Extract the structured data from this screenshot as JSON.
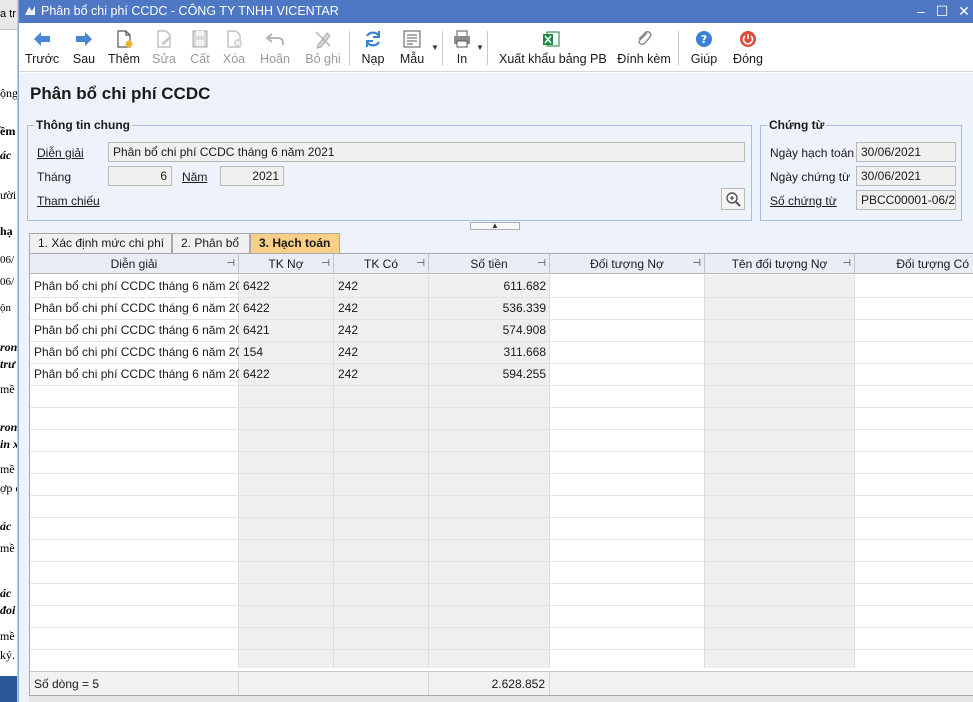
{
  "background_doc": {
    "top_text": "a tr",
    "lines": [
      "ộng",
      "ềm",
      "ác",
      "ười",
      "hạ",
      "06/",
      "06/",
      "ộn",
      "ron",
      "trư",
      "mề",
      "ron",
      "in x",
      "mề",
      "ợp c",
      "ác",
      "mề",
      "ác",
      "đoi",
      "mề",
      "ký."
    ]
  },
  "window": {
    "title": "Phân bổ chi phí CCDC - CÔNG TY TNHH VICENTAR",
    "controls": {
      "minimize": "–",
      "maximize": "☐",
      "close": "✕"
    }
  },
  "toolbar": {
    "items": [
      {
        "label": "Trước",
        "icon": "arrow-left-icon",
        "enabled": true
      },
      {
        "label": "Sau",
        "icon": "arrow-right-icon",
        "enabled": true
      },
      {
        "label": "Thêm",
        "icon": "new-document-icon",
        "enabled": true
      },
      {
        "label": "Sửa",
        "icon": "edit-icon",
        "enabled": false
      },
      {
        "label": "Cất",
        "icon": "save-icon",
        "enabled": false
      },
      {
        "label": "Xóa",
        "icon": "delete-icon",
        "enabled": false
      },
      {
        "label": "Hoãn",
        "icon": "undo-icon",
        "enabled": false
      },
      {
        "label": "Bỏ ghi",
        "icon": "unpost-icon",
        "enabled": false
      },
      {
        "label": "Nạp",
        "icon": "refresh-icon",
        "enabled": true
      },
      {
        "label": "Mẫu",
        "icon": "template-icon",
        "enabled": true
      },
      {
        "label": "In",
        "icon": "print-icon",
        "enabled": true
      },
      {
        "label": "Xuất khẩu bảng PB",
        "icon": "excel-export-icon",
        "enabled": true
      },
      {
        "label": "Đính kèm",
        "icon": "paperclip-icon",
        "enabled": true
      },
      {
        "label": "Giúp",
        "icon": "help-icon",
        "enabled": true
      },
      {
        "label": "Đóng",
        "icon": "power-icon",
        "enabled": true
      }
    ]
  },
  "page_title": "Phân bổ chi phí CCDC",
  "general_info": {
    "group_label": "Thông tin chung",
    "description_label": "Diễn giải",
    "description_value": "Phân bổ chi phí CCDC tháng 6 năm 2021",
    "month_label": "Tháng",
    "month_value": "6",
    "year_label": "Năm",
    "year_value": "2021",
    "reference_label": "Tham chiếu"
  },
  "voucher": {
    "group_label": "Chứng từ",
    "posting_date_label": "Ngày hạch toán",
    "posting_date_value": "30/06/2021",
    "voucher_date_label": "Ngày chứng từ",
    "voucher_date_value": "30/06/2021",
    "voucher_no_label": "Số chứng từ",
    "voucher_no_value": "PBCC00001-06/2"
  },
  "tabs": [
    {
      "label": "1. Xác định mức chi phí",
      "active": false
    },
    {
      "label": "2. Phân bổ",
      "active": false
    },
    {
      "label": "3. Hạch toán",
      "active": true
    }
  ],
  "grid": {
    "columns": [
      "Diễn giải",
      "TK Nợ",
      "TK Có",
      "Số tiền",
      "Đối tượng Nợ",
      "Tên đối tượng Nợ",
      "Đối tượng Có"
    ],
    "rows": [
      {
        "description": "Phân bổ chi phí CCDC tháng 6 năm 20",
        "debit": "6422",
        "credit": "242",
        "amount": "611.682"
      },
      {
        "description": "Phân bổ chi phí CCDC tháng 6 năm 20",
        "debit": "6422",
        "credit": "242",
        "amount": "536.339"
      },
      {
        "description": "Phân bổ chi phí CCDC tháng 6 năm 20",
        "debit": "6421",
        "credit": "242",
        "amount": "574.908"
      },
      {
        "description": "Phân bổ chi phí CCDC tháng 6 năm 20",
        "debit": "154",
        "credit": "242",
        "amount": "311.668"
      },
      {
        "description": "Phân bổ chi phí CCDC tháng 6 năm 20",
        "debit": "6422",
        "credit": "242",
        "amount": "594.255"
      }
    ],
    "footer_count": "Số dòng = 5",
    "footer_total": "2.628.852"
  },
  "colors": {
    "titlebar": "#4e78c4",
    "active_tab": "#f9cf86",
    "form_bg": "#eef2fb",
    "group_border": "#a7bde6"
  }
}
